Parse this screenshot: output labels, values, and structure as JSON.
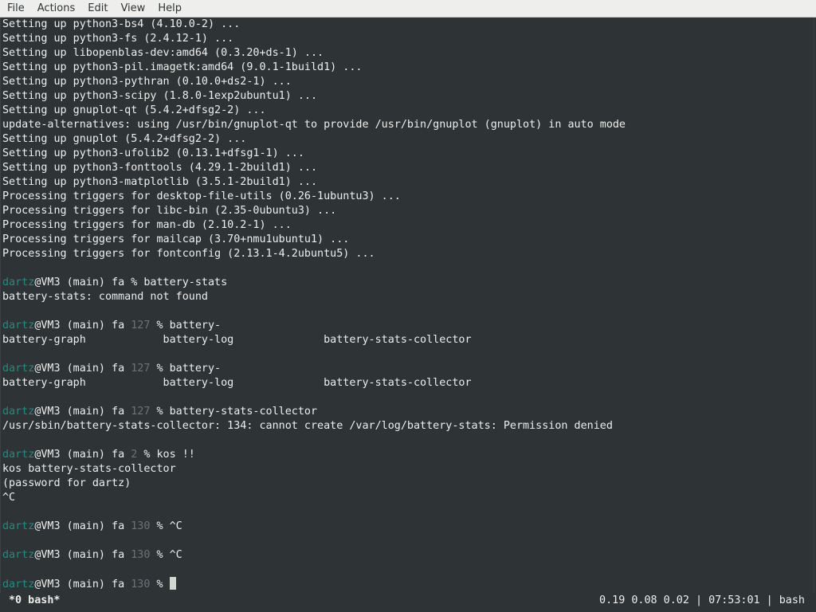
{
  "menubar": {
    "items": [
      "File",
      "Actions",
      "Edit",
      "View",
      "Help"
    ]
  },
  "terminal": {
    "output_lines": [
      "Setting up python3-bs4 (4.10.0-2) ...",
      "Setting up python3-fs (2.4.12-1) ...",
      "Setting up libopenblas-dev:amd64 (0.3.20+ds-1) ...",
      "Setting up python3-pil.imagetk:amd64 (9.0.1-1build1) ...",
      "Setting up python3-pythran (0.10.0+ds2-1) ...",
      "Setting up python3-scipy (1.8.0-1exp2ubuntu1) ...",
      "Setting up gnuplot-qt (5.4.2+dfsg2-2) ...",
      "update-alternatives: using /usr/bin/gnuplot-qt to provide /usr/bin/gnuplot (gnuplot) in auto mode",
      "Setting up gnuplot (5.4.2+dfsg2-2) ...",
      "Setting up python3-ufolib2 (0.13.1+dfsg1-1) ...",
      "Setting up python3-fonttools (4.29.1-2build1) ...",
      "Setting up python3-matplotlib (3.5.1-2build1) ...",
      "Processing triggers for desktop-file-utils (0.26-1ubuntu3) ...",
      "Processing triggers for libc-bin (2.35-0ubuntu3) ...",
      "Processing triggers for man-db (2.10.2-1) ...",
      "Processing triggers for mailcap (3.70+nmu1ubuntu1) ...",
      "Processing triggers for fontconfig (2.13.1-4.2ubuntu5) ..."
    ],
    "prompt": {
      "user": "dartz",
      "host_part": "@VM3 (main) fa"
    },
    "sessions": [
      {
        "status": "",
        "command": "battery-stats",
        "output": [
          "battery-stats: command not found"
        ]
      },
      {
        "status": "127",
        "command": "battery-",
        "output": [
          "battery-graph            battery-log              battery-stats-collector"
        ]
      },
      {
        "status": "127",
        "command": "battery-",
        "output": [
          "battery-graph            battery-log              battery-stats-collector"
        ]
      },
      {
        "status": "127",
        "command": "battery-stats-collector",
        "output": [
          "/usr/sbin/battery-stats-collector: 134: cannot create /var/log/battery-stats: Permission denied"
        ]
      },
      {
        "status": "2",
        "command": "kos !!",
        "output": [
          "kos battery-stats-collector",
          "(password for dartz)",
          "^C"
        ]
      },
      {
        "status": "130",
        "command": "^C",
        "output": []
      },
      {
        "status": "130",
        "command": "^C",
        "output": []
      }
    ],
    "last_prompt_status": "130"
  },
  "statusbar": {
    "window": "*0 bash*",
    "right": "0.19 0.08 0.02 | 07:53:01 | bash"
  }
}
